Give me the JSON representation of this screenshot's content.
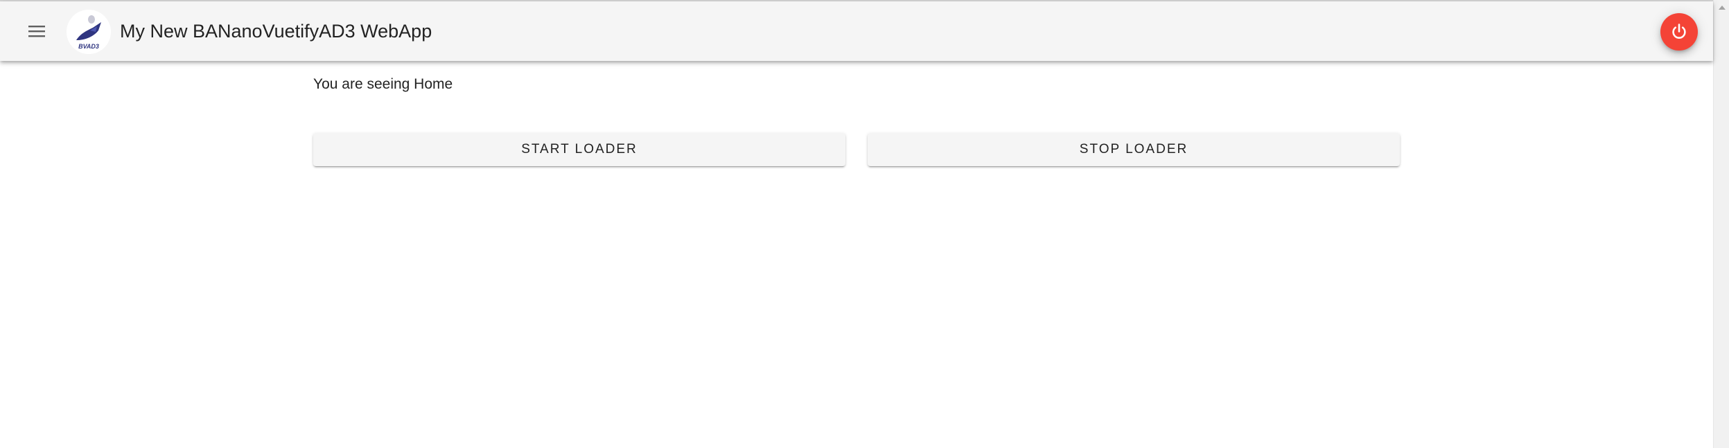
{
  "header": {
    "title": "My New BANanoVuetifyAD3 WebApp",
    "logo_text": "BVAD3",
    "menu_icon": "hamburger-menu-icon",
    "power_icon": "power-icon",
    "power_color": "#f44336",
    "background": "#f5f5f5"
  },
  "main": {
    "home_text": "You are seeing Home",
    "start_label": "START LOADER",
    "stop_label": "STOP LOADER"
  }
}
